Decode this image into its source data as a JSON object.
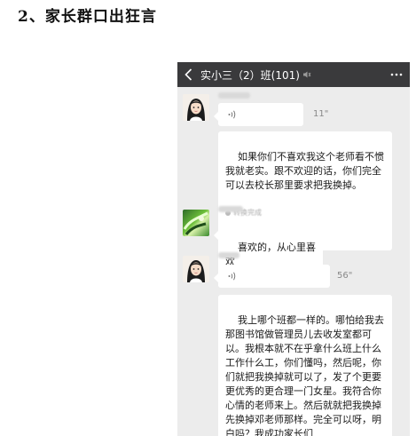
{
  "heading": "2、家长群口出狂言",
  "chat": {
    "title": "实小三（2）班(101)",
    "messages": [
      {
        "type": "voice",
        "duration": "11\"",
        "transcript": "如果你们不喜欢我这个老师看不惯我就老实。跟不欢迎的话，你们完全可以去校长那里要求把我换掉。",
        "convert_note": "转换完成"
      },
      {
        "type": "text",
        "text": "喜欢的，从心里喜欢"
      },
      {
        "type": "voice",
        "duration": "56\"",
        "transcript": "我上哪个班都一样的。哪怕给我去那图书馆做管理员儿去收发室都可以。我根本就不在乎拿什么班上什么工作什么工，你们懂吗，然后呢，你们就把我换掉就可以了，发了个更要更优秀的更合理一门女星。我符合你心情的老师来上。然后就就把我换掉先换掉邓老师那样。完全可以呀，明白吗？我成功家长们"
      }
    ]
  },
  "icons": {
    "back": "chevron-left-icon",
    "speaker": "speaker-icon",
    "more": "more-dots-icon",
    "voice": "voice-wave-icon"
  },
  "colors": {
    "titlebar": "#3a3a3c",
    "chat_background": "#ececec",
    "bubble": "#ffffff"
  }
}
